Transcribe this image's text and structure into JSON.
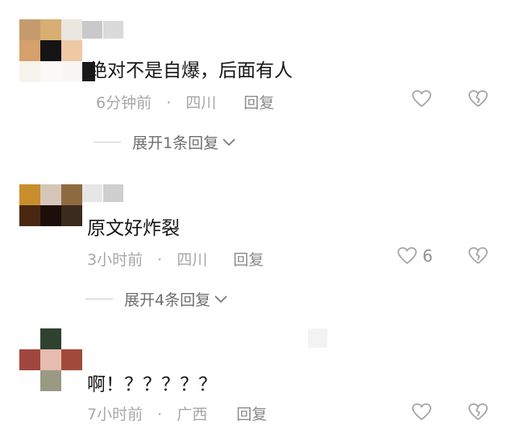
{
  "comments": [
    {
      "text": "绝对不是自爆，后面有人",
      "time": "6分钟前",
      "sep": "·",
      "location": "四川",
      "reply_label": "回复",
      "like_count": "",
      "expand_label": "展开1条回复",
      "avatar_colors": [
        "#c59b6e",
        "#d8ae73",
        "#eae6e0",
        "#d6a06b",
        "#141414",
        "#eec9a4",
        "#f5f3ed",
        "#faf9f6",
        "#f8f7f4"
      ]
    },
    {
      "text": "原文好炸裂",
      "time": "3小时前",
      "sep": "·",
      "location": "四川",
      "reply_label": "回复",
      "like_count": "6",
      "expand_label": "展开4条回复",
      "avatar_colors": [
        "#c88e2c",
        "#d6c6b8",
        "#8e6b3f",
        "#4a2712",
        "#1e0e0b",
        "#3b2a1e",
        "#ffffff",
        "#ffffff",
        "#ffffff"
      ]
    },
    {
      "text": "啊！？？？？？",
      "time": "7小时前",
      "sep": "·",
      "location": "广西",
      "reply_label": "回复",
      "like_count": "",
      "expand_label": "",
      "avatar_colors": [
        "#ffffff",
        "#2f4230",
        "#ffffff",
        "#a0473d",
        "#e6bcb1",
        "#a24a3a",
        "#ffffff",
        "#9a9a83",
        "#ffffff"
      ]
    }
  ],
  "icons": {
    "like": "heart-outline-icon",
    "dislike": "broken-heart-icon",
    "expand": "chevron-down-icon"
  }
}
